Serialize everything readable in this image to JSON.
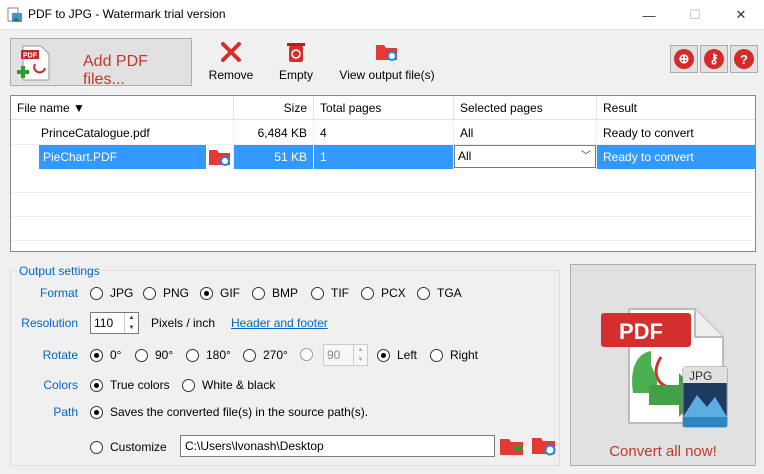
{
  "window": {
    "title": "PDF to JPG - Watermark trial version",
    "minimize": "—",
    "maximize": "☐",
    "close": "✕"
  },
  "toolbar": {
    "add_pdf_label": "Add PDF files...",
    "remove_label": "Remove",
    "empty_label": "Empty",
    "view_output_label": "View output file(s)"
  },
  "grid": {
    "headers": {
      "name": "File name ▼",
      "size": "Size",
      "total": "Total pages",
      "selected": "Selected pages",
      "result": "Result"
    },
    "rows": [
      {
        "name": "PrinceCatalogue.pdf",
        "size": "6,484 KB",
        "total": "4",
        "selected": "All",
        "result": "Ready to convert"
      },
      {
        "name": "PieChart.PDF",
        "size": "51 KB",
        "total": "1",
        "selected": "All",
        "result": "Ready to convert"
      }
    ]
  },
  "settings": {
    "legend": "Output settings",
    "format_label": "Format",
    "formats": [
      "JPG",
      "PNG",
      "GIF",
      "BMP",
      "TIF",
      "PCX",
      "TGA"
    ],
    "selected_format": "GIF",
    "resolution_label": "Resolution",
    "resolution_value": "110",
    "resolution_unit": "Pixels / inch",
    "header_footer_link": "Header and footer",
    "rotate_label": "Rotate",
    "rotations": [
      "0°",
      "90°",
      "180°",
      "270°"
    ],
    "selected_rotation": "0°",
    "custom_rotation": "90",
    "left_label": "Left",
    "right_label": "Right",
    "colors_label": "Colors",
    "true_colors": "True colors",
    "white_black": "White & black",
    "path_label": "Path",
    "source_path_option": "Saves the converted file(s) in the source path(s).",
    "customize_label": "Customize",
    "custom_path": "C:\\Users\\lvonash\\Desktop"
  },
  "convert": {
    "label": "Convert all now!",
    "pdf_tag": "PDF",
    "jpg_tag": "JPG"
  },
  "colors": {
    "accent_red": "#c0392b",
    "link_blue": "#0066cc",
    "selection_blue": "#3399ff"
  }
}
